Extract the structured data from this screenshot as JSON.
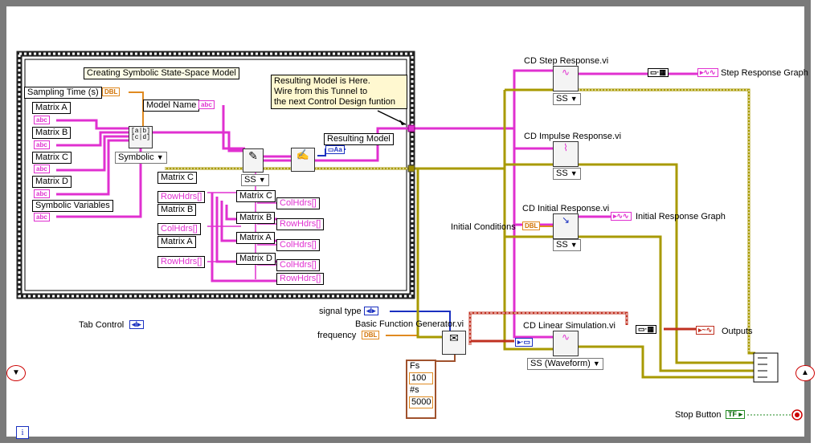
{
  "tab": {
    "page_label": "Creating Symbolic State-Space Model",
    "control_label": "Tab Control"
  },
  "inputs": {
    "sampling_time": "Sampling Time (s)",
    "model_name": "Model Name",
    "matrix_a": "Matrix A",
    "matrix_b": "Matrix B",
    "matrix_c": "Matrix C",
    "matrix_d": "Matrix D",
    "symbolic_variables": "Symbolic Variables",
    "symbolic_select": "Symbolic",
    "signal_type": "signal type",
    "frequency": "frequency",
    "initial_conditions": "Initial Conditions"
  },
  "types": {
    "dbl": "DBL",
    "abc": "abc",
    "tf": "TF"
  },
  "notes": {
    "line1": "Resulting Model is Here.",
    "line2": "Wire from this Tunnel to",
    "line3": "the next Control Design funtion"
  },
  "outputs": {
    "resulting_model": "Resulting Model",
    "step_graph": "Step Response Graph",
    "initial_graph": "Initial Response Graph",
    "outputs": "Outputs"
  },
  "props": {
    "matrix_c": "Matrix C",
    "matrix_b": "Matrix B",
    "matrix_a": "Matrix A",
    "matrix_d": "Matrix D",
    "row_hdrs": "RowHdrs[]",
    "col_hdrs": "ColHdrs[]"
  },
  "ss_labels": {
    "ss": "SS",
    "ss_waveform": "SS (Waveform)"
  },
  "vis": {
    "step": "CD Step Response.vi",
    "impulse": "CD Impulse Response.vi",
    "initial": "CD Initial Response.vi",
    "linear": "CD Linear Simulation.vi",
    "basic_gen": "Basic Function Generator.vi"
  },
  "cluster": {
    "fs_label": "Fs",
    "fs_value": "100",
    "ns_label": "#s",
    "ns_value": "5000"
  },
  "stop": {
    "label": "Stop Button"
  },
  "info_icon": "i",
  "colors": {
    "frame": "#7a7a7a",
    "pink_wire": "#e030d0",
    "orange_wire": "#e08a20",
    "blue_wire": "#1a30c0",
    "yellow_wire": "#c8b400",
    "red_wire": "#c03020",
    "green_wire": "#228b22",
    "note_bg": "#fff8d0"
  }
}
